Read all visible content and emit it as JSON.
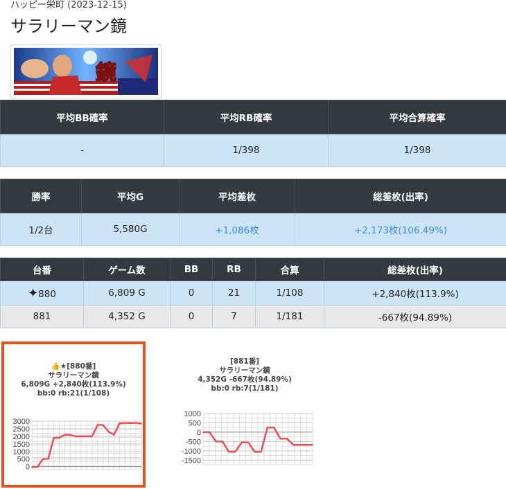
{
  "header": {
    "store_date": "ハッピー栄町 (2023-12-15)",
    "machine_title": "サラリーマン鏡"
  },
  "banner": {
    "image_text": "鏡"
  },
  "summary_table": {
    "headers": [
      "平均BB確率",
      "平均RB確率",
      "平均合算確率"
    ],
    "values": [
      "-",
      "1/398",
      "1/398"
    ]
  },
  "stats_table": {
    "headers": [
      "勝率",
      "平均G",
      "平均差枚",
      "総差枚(出率)"
    ],
    "values": [
      "1/2台",
      "5,580G",
      "+1,086枚",
      "+2,173枚(106.49%)"
    ]
  },
  "machines_table": {
    "headers": [
      "台番",
      "ゲーム数",
      "BB",
      "RB",
      "合算",
      "総差枚(出率)"
    ],
    "rows": [
      {
        "number": "880",
        "games": "6,809 G",
        "bb": "0",
        "rb": "21",
        "total": "1/108",
        "diff": "+2,840枚(113.9%)"
      },
      {
        "number": "881",
        "games": "4,352 G",
        "bb": "0",
        "rb": "7",
        "total": "1/181",
        "diff": "-667枚(94.89%)"
      }
    ]
  },
  "colors": {
    "highlight_border": "#e0521f",
    "line": "#ef4b55",
    "header_bg": "#343a40",
    "row_blue": "#cde4f7"
  },
  "chart_data": [
    {
      "type": "line",
      "caption_lines": [
        "👍★[880番]",
        "サラリーマン鏡",
        "6,809G +2,840枚(113.9%)",
        "bb:0 rb:21(1/108)"
      ],
      "yticks": [
        "3000",
        "2500",
        "2000",
        "1500",
        "1000",
        "500",
        "0"
      ],
      "ylim": [
        -200,
        3000
      ],
      "x": [
        0,
        1,
        2,
        3,
        4,
        5,
        6,
        7,
        8,
        9,
        10,
        11,
        12,
        13,
        14,
        15,
        16,
        17,
        18,
        19,
        20
      ],
      "values": [
        -30,
        -30,
        500,
        520,
        1900,
        1900,
        2100,
        2100,
        2000,
        2000,
        2000,
        2000,
        2750,
        2750,
        2300,
        2100,
        2850,
        2870,
        2870,
        2870,
        2840
      ]
    },
    {
      "type": "line",
      "caption_lines": [
        "[881番]",
        "サラリーマン鏡",
        "4,352G -667枚(94.89%)",
        "bb:0 rb:7(1/181)"
      ],
      "yticks": [
        "1000",
        "500",
        "0",
        "-500",
        "-1000",
        "-1500"
      ],
      "ylim": [
        -1750,
        1000
      ],
      "x": [
        0,
        1,
        2,
        3,
        4,
        5,
        6,
        7,
        8,
        9,
        10,
        11,
        12,
        13,
        14,
        15,
        16,
        17
      ],
      "values": [
        0,
        0,
        -500,
        -500,
        -1050,
        -1050,
        -550,
        -550,
        -1050,
        -1050,
        250,
        250,
        -350,
        -350,
        -680,
        -680,
        -680,
        -680
      ]
    }
  ]
}
